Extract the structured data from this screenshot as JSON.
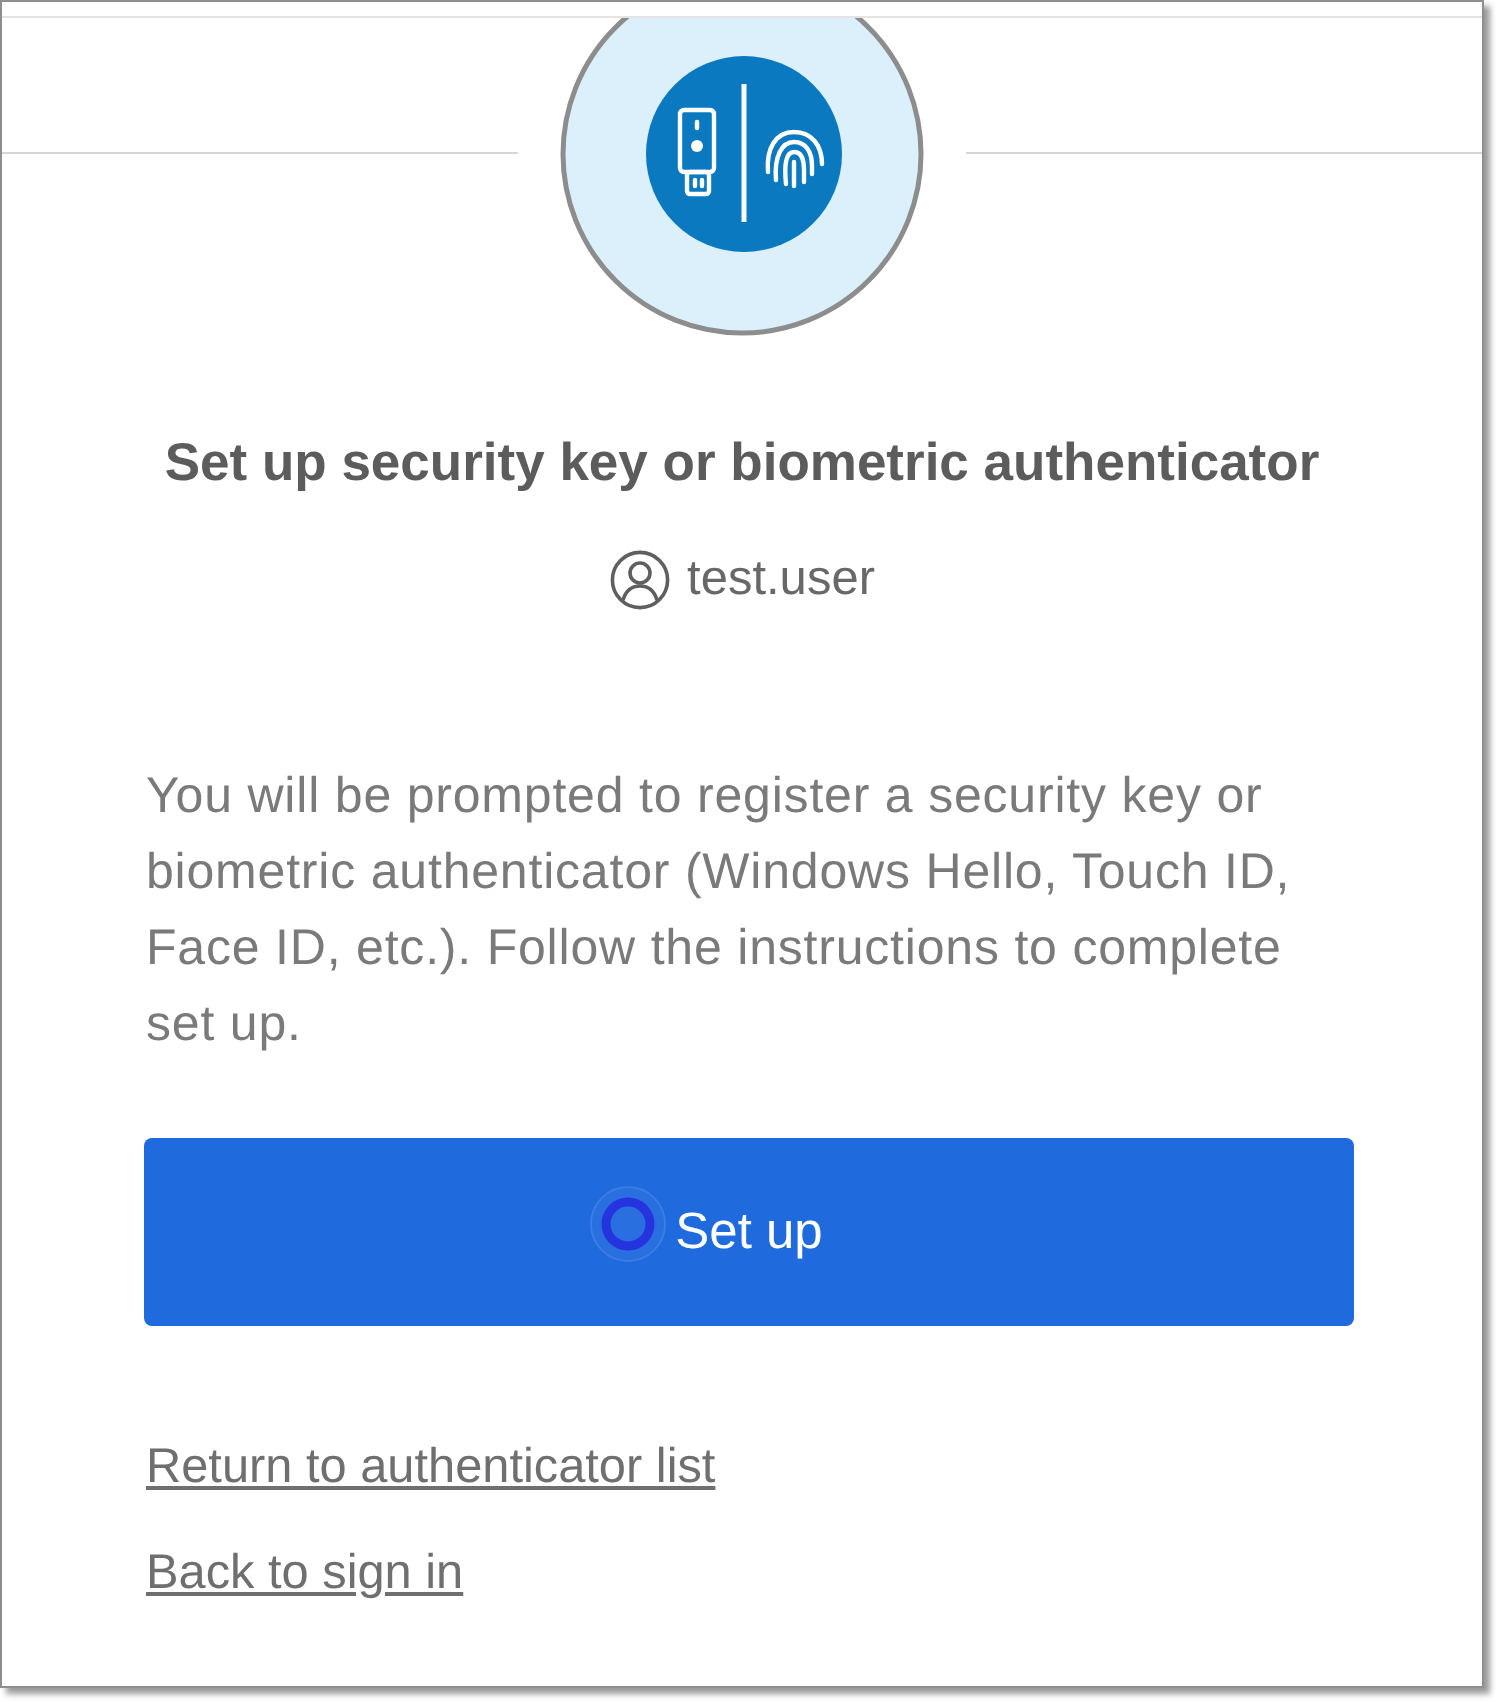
{
  "header": {
    "title": "Set up security key or biometric authenticator",
    "username": "test.user"
  },
  "instructions": "You will be prompted to register a security key or biometric authenticator (Windows Hello, Touch ID, Face ID, etc.). Follow the instructions to complete set up.",
  "primary_button": {
    "label": "Set up"
  },
  "links": [
    {
      "label": "Return to authenticator list"
    },
    {
      "label": "Back to sign in"
    }
  ]
}
